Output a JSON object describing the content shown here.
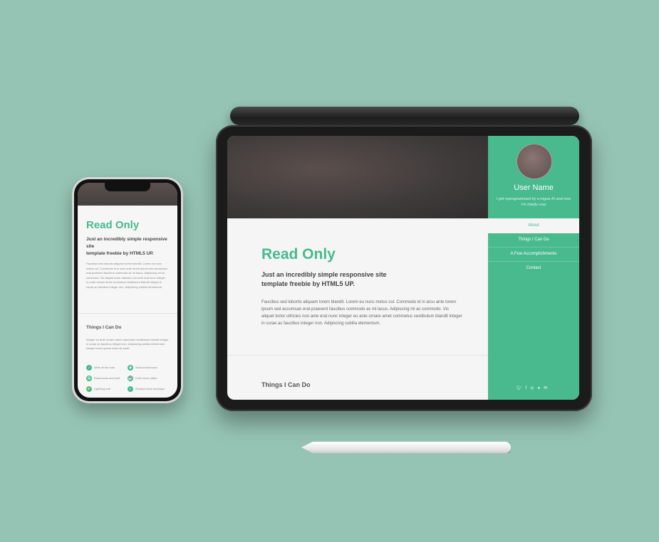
{
  "colors": {
    "accent": "#48ba8e",
    "background": "#96c4b4"
  },
  "tablet": {
    "sidebar": {
      "user_name": "User Name",
      "bio": "I got reprogrammed by a rogue AI and now I'm totally cray",
      "nav": [
        {
          "label": "About",
          "active": true
        },
        {
          "label": "Things I Can Do",
          "active": false
        },
        {
          "label": "A Few Accomplishments",
          "active": false
        },
        {
          "label": "Contact",
          "active": false
        }
      ],
      "social_icons": [
        "twitter-icon",
        "facebook-icon",
        "instagram-icon",
        "github-icon",
        "email-icon"
      ]
    },
    "main": {
      "title": "Read Only",
      "subtitle_line1": "Just an incredibly simple responsive site",
      "subtitle_line2": "template freebie by HTML5 UP.",
      "paragraph": "Faucibus sed lobortis aliquam lorem blandit. Lorem eu nunc metus col. Commodo id in arcu ante lorem ipsum sed accumsan erat praesent faucibus commodo ac mi lacus. Adipiscing mi ac commodo. Vis aliquet tortor ultricies non ante erat nunc integer eu ante ornare amet commetus vestibulum blandit integer in curae ac faucibus integer non. Adipiscing cubilia elementum.",
      "section_title": "Things I Can Do"
    }
  },
  "phone": {
    "title": "Read Only",
    "subtitle_line1": "Just an incredibly simple responsive",
    "subtitle_line2": "site",
    "subtitle_line3": "template freebie by HTML5 UP.",
    "paragraph": "Faucibus sed lobortis aliquam lorem blandit. Lorem eu nunc metus col. Commodo id in arcu ante lorem ipsum sed accumsan erat praesent faucibus commodo ac mi lacus. Adipiscing mi ac commodo. Vis aliquet tortor ultricies non ante erat nunc integer eu ante ornare amet commetus vestibulum blandit integer in curae ac faucibus integer non. Adipiscing cubilia elementum.",
    "section_title": "Things I Can Do",
    "paragraph2": "Integer eu ante ornare amet commetus vestibulum blandit integer in curae ac faucibus integer non. Adipiscing cubilia elementum integer lorem ipsum dolor sit amet.",
    "features": [
      {
        "icon": "sound-icon",
        "label": "Write all the code"
      },
      {
        "icon": "camera-icon",
        "label": "Stack small boxes"
      },
      {
        "icon": "book-icon",
        "label": "Read books and stuff"
      },
      {
        "icon": "coffee-icon",
        "label": "Drink much coffee"
      },
      {
        "icon": "lightning-icon",
        "label": "Lightning bolt"
      },
      {
        "icon": "shadow-icon",
        "label": "Shadow clone technique"
      }
    ]
  }
}
